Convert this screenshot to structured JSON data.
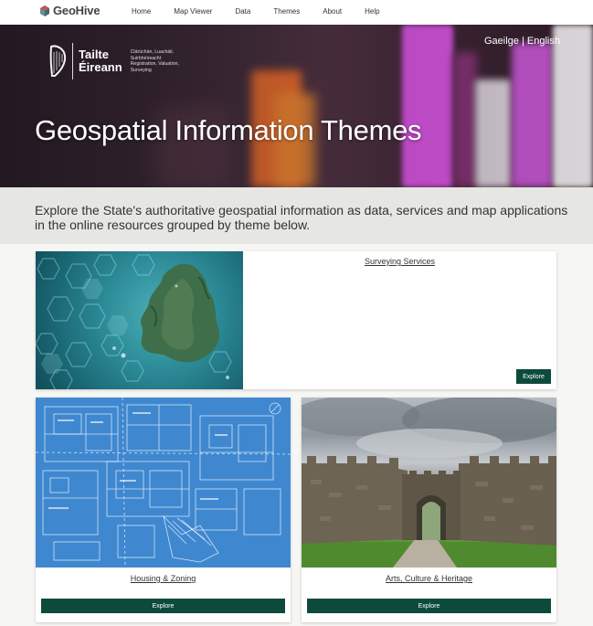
{
  "nav": {
    "logo_text": "GeoHive",
    "items": [
      {
        "label": "Home"
      },
      {
        "label": "Map Viewer"
      },
      {
        "label": "Data"
      },
      {
        "label": "Themes"
      },
      {
        "label": "About"
      },
      {
        "label": "Help"
      }
    ]
  },
  "hero": {
    "org_name_line1": "Tailte",
    "org_name_line2": "Éireann",
    "org_sub_line1": "Clárúchán, Luacháil,",
    "org_sub_line2": "Suirbhéireacht",
    "org_sub_line3": "Registration, Valuation,",
    "org_sub_line4": "Surveying",
    "lang_irish": "Gaeilge",
    "lang_sep": "|",
    "lang_english": "English",
    "title": "Geospatial Information Themes"
  },
  "intro": {
    "text": "Explore the State's authoritative geospatial information as data, services and map applications in the online resources grouped by theme below."
  },
  "cards": [
    {
      "title": "Surveying Services",
      "button": "Explore"
    },
    {
      "title": "Housing & Zoning",
      "button": "Explore"
    },
    {
      "title": "Arts, Culture & Heritage",
      "button": "Explore"
    }
  ],
  "colors": {
    "accent_button": "#0d4a3c",
    "intro_band": "#e6e6e3",
    "blueprint": "#3f88d0"
  }
}
